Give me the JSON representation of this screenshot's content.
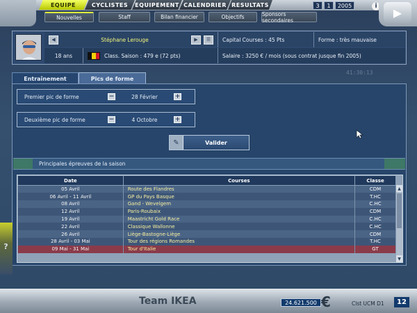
{
  "colors": {
    "accent_yellow": "#e0ef3a",
    "panel_blue": "#27446a",
    "highlight_row": "#8a3b4a",
    "race_text": "#f8f0a0"
  },
  "main_tabs": [
    {
      "label": "EQUIPE",
      "active": true
    },
    {
      "label": "CYCLISTES",
      "active": false
    },
    {
      "label": "EQUIPEMENT",
      "active": false
    },
    {
      "label": "CALENDRIER",
      "active": false
    },
    {
      "label": "RESULTATS",
      "active": false
    }
  ],
  "sub_tabs": [
    {
      "label": "Nouvelles"
    },
    {
      "label": "Staff"
    },
    {
      "label": "Bilan financier"
    },
    {
      "label": "Objectifs"
    },
    {
      "label": "Sponsors secondaires"
    }
  ],
  "date": {
    "day": "3",
    "month": "1",
    "year": "2005"
  },
  "icons": {
    "info": "info-icon",
    "play": "play-icon",
    "prev": "arrow-left-icon",
    "next": "arrow-right-icon",
    "list": "list-icon",
    "help": "help-icon",
    "cursor": "mouse-cursor-icon"
  },
  "rider": {
    "name": "Stéphane Lerouge",
    "age": "18 ans",
    "flag": "Belgium",
    "class_saison": "Class. Saison : 479 e (72 pts)",
    "capital": "Capital Courses : 45 Pts",
    "forme": "Forme : très mauvaise",
    "salaire": "Salaire : 3250 € / mois (sous contrat jusque fin 2005)"
  },
  "panel_tabs": [
    {
      "label": "Entraînement"
    },
    {
      "label": "Pics de forme"
    }
  ],
  "form": {
    "premier_label": "Premier pic de forme",
    "premier_value": "28 Février",
    "deuxieme_label": "Deuxième pic de forme",
    "deuxieme_value": "4 Octobre",
    "minus": "−",
    "plus": "+"
  },
  "valider_label": "Valider",
  "races_title": "Principales épreuves de la saison",
  "table": {
    "headers": [
      "Date",
      "Courses",
      "Classe"
    ],
    "rows": [
      {
        "date": "05 Avril",
        "course": "Route des Flandres",
        "classe": "CDM"
      },
      {
        "date": "06 Avril - 11 Avril",
        "course": "GP du Pays Basque",
        "classe": "T.HC"
      },
      {
        "date": "08 Avril",
        "course": "Gand - Wevelgem",
        "classe": "C.HC"
      },
      {
        "date": "12 Avril",
        "course": "Paris-Roubaix",
        "classe": "CDM"
      },
      {
        "date": "19 Avril",
        "course": "Maastricht Gold Race",
        "classe": "C.HC"
      },
      {
        "date": "22 Avril",
        "course": "Classique Wallonne",
        "classe": "C.HC"
      },
      {
        "date": "26 Avril",
        "course": "Liège-Bastogne-Liège",
        "classe": "CDM"
      },
      {
        "date": "28 Avril - 03 Mai",
        "course": "Tour des régions Romandes",
        "classe": "T.HC"
      },
      {
        "date": "09 Mai - 31 Mai",
        "course": "Tour d'Italie",
        "classe": "GT"
      }
    ]
  },
  "bottom": {
    "team": "Team IKEA",
    "money": "24.621.500",
    "currency": "€",
    "ranking_label": "Clst UCM  D1",
    "ranking_value": "12"
  },
  "bg_clock": "41:30:13"
}
